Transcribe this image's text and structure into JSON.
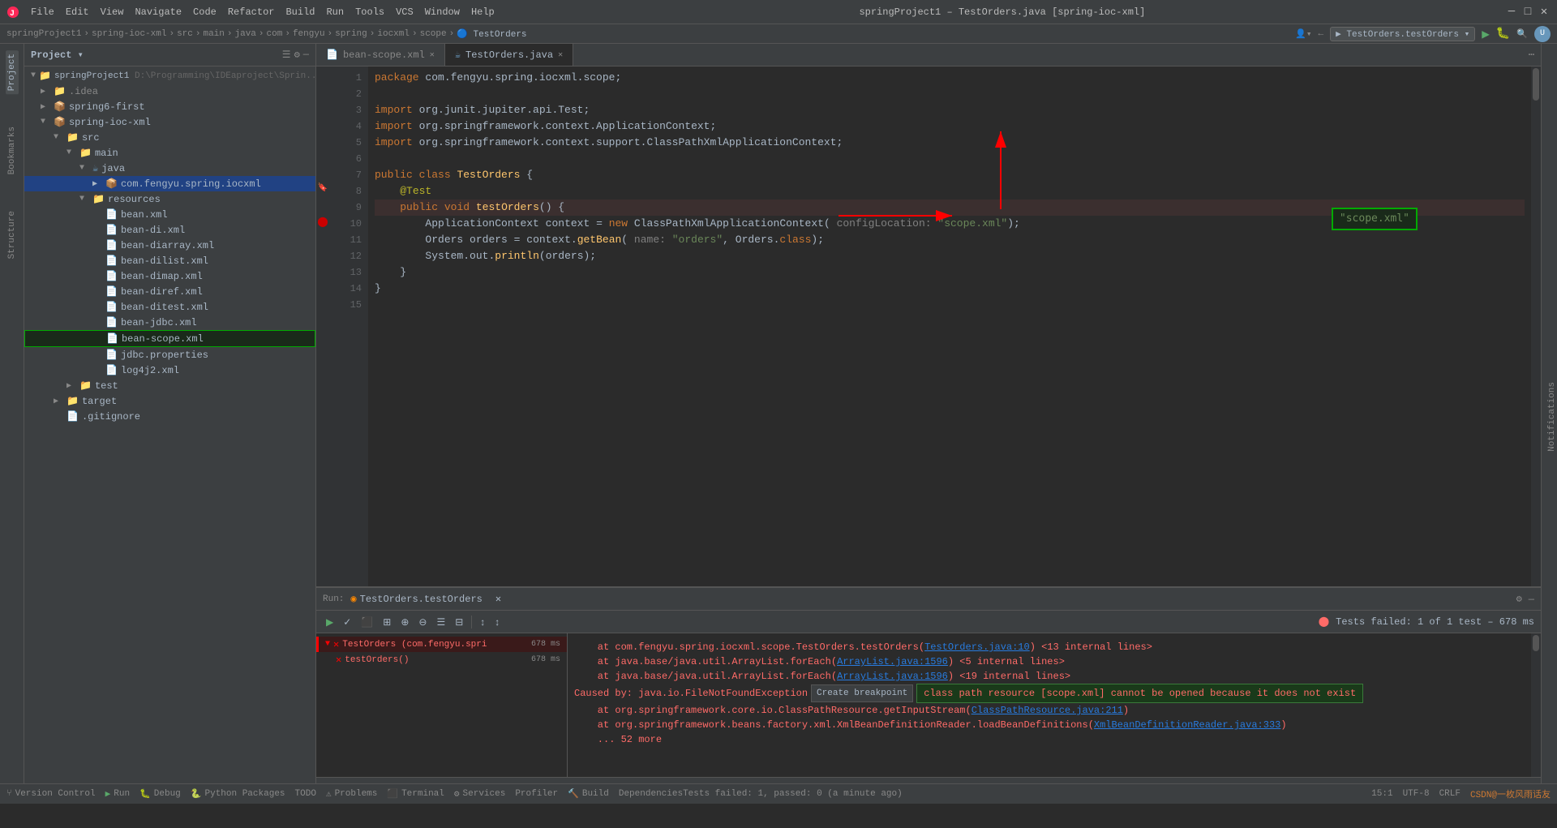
{
  "titlebar": {
    "menus": [
      "File",
      "Edit",
      "View",
      "Navigate",
      "Code",
      "Refactor",
      "Build",
      "Run",
      "Tools",
      "VCS",
      "Window",
      "Help"
    ],
    "title": "springProject1 – TestOrders.java [spring-ioc-xml]",
    "run_config": "TestOrders.testOrders"
  },
  "breadcrumb": {
    "items": [
      "springProject1",
      "spring-ioc-xml",
      "src",
      "main",
      "java",
      "com",
      "fengyu",
      "spring",
      "iocxml",
      "scope",
      "TestOrders"
    ]
  },
  "sidebar": {
    "title": "Project",
    "tree": [
      {
        "label": "springProject1 D:\\Programming\\IDEaproject\\Sprin...",
        "level": 0,
        "type": "project",
        "expanded": true
      },
      {
        "label": ".idea",
        "level": 1,
        "type": "folder",
        "expanded": false
      },
      {
        "label": "spring6-first",
        "level": 1,
        "type": "module",
        "expanded": false
      },
      {
        "label": "spring-ioc-xml",
        "level": 1,
        "type": "module",
        "expanded": true
      },
      {
        "label": "src",
        "level": 2,
        "type": "folder",
        "expanded": true
      },
      {
        "label": "main",
        "level": 3,
        "type": "folder",
        "expanded": true
      },
      {
        "label": "java",
        "level": 4,
        "type": "folder",
        "expanded": true
      },
      {
        "label": "com.fengyu.spring.iocxml",
        "level": 5,
        "type": "package",
        "expanded": true,
        "selected": true
      },
      {
        "label": "resources",
        "level": 4,
        "type": "folder",
        "expanded": true
      },
      {
        "label": "bean.xml",
        "level": 5,
        "type": "xml"
      },
      {
        "label": "bean-di.xml",
        "level": 5,
        "type": "xml"
      },
      {
        "label": "bean-diarray.xml",
        "level": 5,
        "type": "xml"
      },
      {
        "label": "bean-dilist.xml",
        "level": 5,
        "type": "xml"
      },
      {
        "label": "bean-dimap.xml",
        "level": 5,
        "type": "xml"
      },
      {
        "label": "bean-diref.xml",
        "level": 5,
        "type": "xml"
      },
      {
        "label": "bean-ditest.xml",
        "level": 5,
        "type": "xml"
      },
      {
        "label": "bean-jdbc.xml",
        "level": 5,
        "type": "xml"
      },
      {
        "label": "bean-scope.xml",
        "level": 5,
        "type": "xml",
        "highlighted": true
      },
      {
        "label": "jdbc.properties",
        "level": 5,
        "type": "props"
      },
      {
        "label": "log4j2.xml",
        "level": 5,
        "type": "xml"
      },
      {
        "label": "test",
        "level": 3,
        "type": "folder",
        "expanded": false
      },
      {
        "label": "target",
        "level": 2,
        "type": "folder",
        "expanded": false
      },
      {
        "label": ".gitignore",
        "level": 2,
        "type": "file"
      }
    ]
  },
  "editor": {
    "tabs": [
      {
        "label": "bean-scope.xml",
        "active": false,
        "icon": "xml"
      },
      {
        "label": "TestOrders.java",
        "active": true,
        "icon": "java"
      }
    ],
    "lines": [
      {
        "num": 1,
        "code": "package com.fengyu.spring.iocxml.scope;"
      },
      {
        "num": 2,
        "code": ""
      },
      {
        "num": 3,
        "code": "import org.junit.jupiter.api.Test;"
      },
      {
        "num": 4,
        "code": "import org.springframework.context.ApplicationContext;"
      },
      {
        "num": 5,
        "code": "import org.springframework.context.support.ClassPathXmlApplicationContext;"
      },
      {
        "num": 6,
        "code": ""
      },
      {
        "num": 7,
        "code": "public class TestOrders {"
      },
      {
        "num": 8,
        "code": "    @Test"
      },
      {
        "num": 9,
        "code": "    public void testOrders() {"
      },
      {
        "num": 10,
        "code": "        ApplicationContext context = new ClassPathXmlApplicationContext( configLocation: \"scope.xml\");"
      },
      {
        "num": 11,
        "code": "        Orders orders = context.getBean( name: \"orders\", Orders.class);"
      },
      {
        "num": 12,
        "code": "        System.out.println(orders);"
      },
      {
        "num": 13,
        "code": "    }"
      },
      {
        "num": 14,
        "code": "}"
      },
      {
        "num": 15,
        "code": ""
      }
    ]
  },
  "run_panel": {
    "title": "Run:",
    "tab": "TestOrders.testOrders",
    "status": "Tests failed: 1 of 1 test – 678 ms",
    "test_tree": [
      {
        "label": "TestOrders (com.fengyu.spri",
        "time": "678 ms",
        "status": "fail",
        "expanded": true
      },
      {
        "label": "testOrders()",
        "time": "678 ms",
        "status": "fail",
        "indent": 1
      }
    ],
    "output": [
      {
        "text": "    at com.fengyu.spring.iocxml.scope.TestOrders.testOrders(TestOrders.java:10) <13 internal lines>",
        "type": "error"
      },
      {
        "text": "    at java.base/java.util.ArrayList.forEach(ArrayList.java:1596) <5 internal lines>",
        "type": "error"
      },
      {
        "text": "    at java.base/java.util.ArrayList.forEach(ArrayList.java:1596) <19 internal lines>",
        "type": "error"
      },
      {
        "text": "Caused by: java.io.FileNotFoundException    class path resource [scope.xml] cannot be opened because it does not exist",
        "type": "cause"
      },
      {
        "text": "    at org.springframework.core.io.ClassPathResource.getInputStream(ClassPathResource.java:211)",
        "type": "error"
      },
      {
        "text": "    at org.springframework.beans.factory.xml.XmlBeanDefinitionReader.loadBeanDefinitions(XmlBeanDefinitionReader.java:333)",
        "type": "error"
      },
      {
        "text": "    ... 52 more",
        "type": "error"
      }
    ]
  },
  "statusbar": {
    "left": "Tests failed: 1, passed: 0 (a minute ago)",
    "items": [
      "Version Control",
      "Run",
      "Debug",
      "Python Packages",
      "TODO",
      "Problems",
      "Terminal",
      "Services",
      "Profiler",
      "Build",
      "Dependencies"
    ],
    "right": "15:1",
    "encoding": "CRLF",
    "charset": "UTF-8",
    "info": "CSDN@一枚风雨话友"
  },
  "annotations": {
    "scope_box_label": "scope.xml",
    "bean_scope_file": "bean-scope.xml",
    "create_breakpoint": "Create breakpoint",
    "error_message": "class path resource [scope.xml] cannot be opened because it does not exist"
  }
}
